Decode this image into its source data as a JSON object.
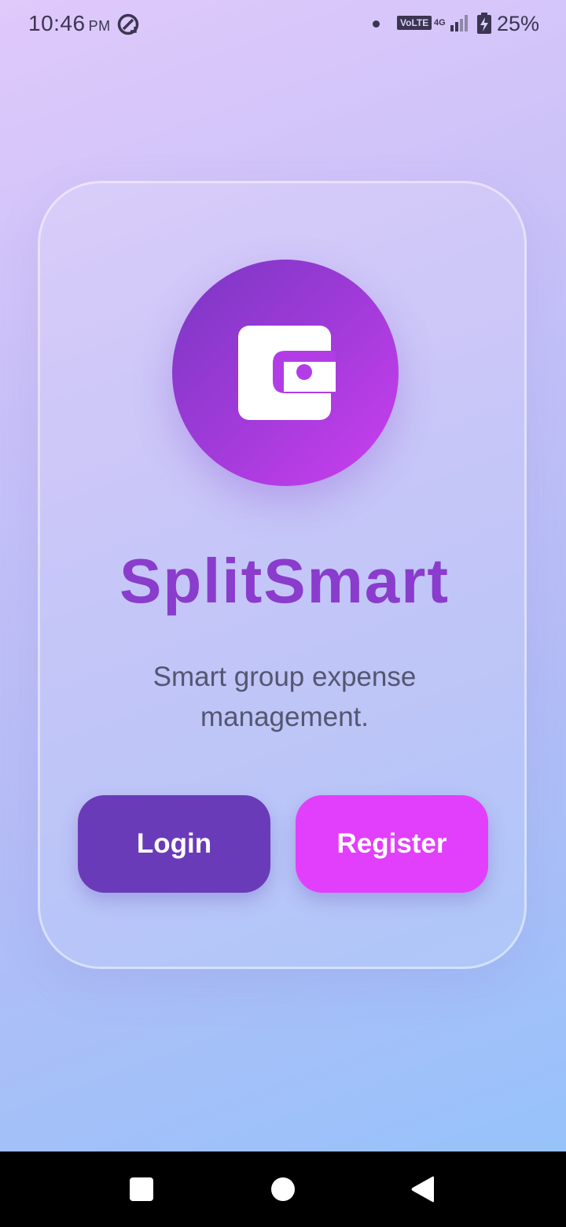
{
  "status_bar": {
    "time": "10:46",
    "ampm": "PM",
    "volte": "VoLTE",
    "network": "4G",
    "battery": "25%",
    "icons": [
      "location-q-icon",
      "notification-dot-icon",
      "signal-icon",
      "battery-charging-icon"
    ]
  },
  "app": {
    "title": "SplitSmart",
    "tagline": "Smart group expense management.",
    "logo_icon": "wallet-icon"
  },
  "actions": {
    "login_label": "Login",
    "register_label": "Register"
  },
  "nav_bar": {
    "icons": [
      "recents-square-icon",
      "home-circle-icon",
      "back-triangle-icon"
    ]
  },
  "colors": {
    "title": "#8a3ccc",
    "login_button": "#6a3bb9",
    "register_button": "#e23ffc",
    "logo_gradient_start": "#7a37c4",
    "logo_gradient_end": "#cb3ff0"
  }
}
